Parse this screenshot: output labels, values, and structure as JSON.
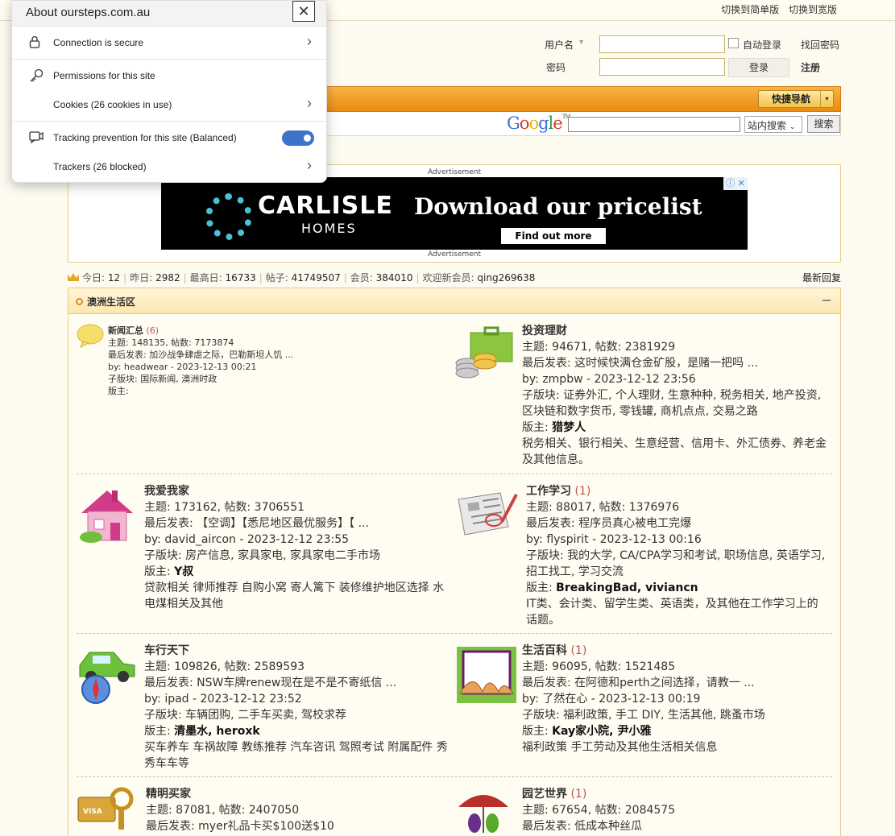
{
  "topbar": {
    "simplified": "切换到简单版",
    "wide": "切换到宽版"
  },
  "login": {
    "username_label": "用户名",
    "username_caret": "▾",
    "password_label": "密码",
    "auto_login": "自动登录",
    "forgot_password": "找回密码",
    "login_button": "登录",
    "register": "注册"
  },
  "nav": {
    "quick_nav": "快捷导航",
    "caret": "▾"
  },
  "search": {
    "google_letters": [
      "G",
      "o",
      "o",
      "g",
      "l",
      "e"
    ],
    "google_trademark": "TM",
    "scope": "站内搜索",
    "button": "搜索"
  },
  "advert": {
    "label_top": "Advertisement",
    "label_bottom": "Advertisement",
    "brand": "CARLISLE",
    "brand_sub": "HOMES",
    "pitch": "Download our pricelist",
    "cta": "Find out more",
    "info": "ⓘ",
    "close": "✕"
  },
  "stats": {
    "today_label": "今日:",
    "today": "12",
    "yesterday_label": "昨日:",
    "yesterday": "2982",
    "max_label": "最高日:",
    "max": "16733",
    "posts_label": "帖子:",
    "posts": "41749507",
    "members_label": "会员:",
    "members": "384010",
    "newest_label": "欢迎新会员:",
    "newest": "qing269638",
    "latest_replies": "最新回复"
  },
  "section": {
    "title": "澳洲生活区",
    "collapse": "−"
  },
  "forums": [
    {
      "name": "新闻汇总",
      "new": "(6)",
      "stats": "主题: 148135, 帖数: 7173874",
      "last": "最后发表: 加沙战争肆虐之际，巴勒斯坦人饥 ...",
      "by": "by: headwear - 2023-12-13 00:21",
      "subs": "子版块: 国际新闻, 澳洲时政",
      "mods_label": "版主:",
      "mods": "",
      "desc": ""
    },
    {
      "name": "投资理财",
      "new": "",
      "stats": "主题: 94671, 帖数: 2381929",
      "last": "最后发表: 这时候快满仓金矿股，是赌一把吗 ...",
      "by": "by: zmpbw - 2023-12-12 23:56",
      "subs": "子版块: 证券外汇, 个人理财, 生意种种, 税务相关, 地产投资, 区块链和数字货币, 零钱罐, 商机点点, 交易之路",
      "mods_label": "版主:",
      "mods": "猎梦人",
      "desc": "税务相关、银行相关、生意经营、信用卡、外汇债券、养老金 及其他信息。"
    },
    {
      "name": "我爱我家",
      "new": "",
      "stats": "主题: 173162, 帖数: 3706551",
      "last": "最后发表: 【空调】【悉尼地区最优服务】【 ...",
      "by": "by: david_aircon - 2023-12-12 23:55",
      "subs": "子版块: 房产信息, 家具家电, 家具家电二手市场",
      "mods_label": "版主:",
      "mods": "Y叔",
      "desc": "贷款相关 律师推荐 自购小窝 寄人篱下 装修维护地区选择 水电煤相关及其他"
    },
    {
      "name": "工作学习",
      "new": "(1)",
      "stats": "主题: 88017, 帖数: 1376976",
      "last": "最后发表: 程序员真心被电工完爆",
      "by": "by: flyspirit - 2023-12-13 00:16",
      "subs": "子版块: 我的大学, CA/CPA学习和考试, 职场信息, 英语学习, 招工找工, 学习交流",
      "mods_label": "版主:",
      "mods": "BreakingBad, viviancn",
      "desc": "IT类、会计类、留学生类、英语类，及其他在工作学习上的话题。"
    },
    {
      "name": "车行天下",
      "new": "",
      "stats": "主题: 109826, 帖数: 2589593",
      "last": "最后发表: NSW车牌renew现在是不是不寄纸信 ...",
      "by": "by: ipad - 2023-12-12 23:52",
      "subs": "子版块: 车辆团购, 二手车买卖, 驾校求荐",
      "mods_label": "版主:",
      "mods": "清墨水, heroxk",
      "desc": "买车养车 车祸故障 教练推荐 汽车咨讯 驾照考试 附属配件 秀秀车车等"
    },
    {
      "name": "生活百科",
      "new": "(1)",
      "stats": "主题: 96095, 帖数: 1521485",
      "last": "最后发表: 在阿德和perth之间选择，请教一 ...",
      "by": "by: 了然在心 - 2023-12-13 00:19",
      "subs": "子版块: 福利政策, 手工 DIY, 生活其他, 跳蚤市场",
      "mods_label": "版主:",
      "mods": "Kay家小院, 尹小雅",
      "desc": "福利政策  手工劳动及其他生活相关信息"
    },
    {
      "name": "精明买家",
      "new": "",
      "stats": "主题: 87081, 帖数: 2407050",
      "last": "最后发表: myer礼品卡买$100送$10"
    },
    {
      "name": "园艺世界",
      "new": "(1)",
      "stats": "主题: 67654, 帖数: 2084575",
      "last": "最后发表: 低成本种丝瓜"
    }
  ],
  "popup": {
    "title": "About oursteps.com.au",
    "close": "✕",
    "connection": "Connection is secure",
    "permissions": "Permissions for this site",
    "cookies": "Cookies (26 cookies in use)",
    "tracking": "Tracking prevention for this site (Balanced)",
    "tracking_on": true,
    "trackers": "Trackers (26 blocked)",
    "chevron": "›"
  }
}
